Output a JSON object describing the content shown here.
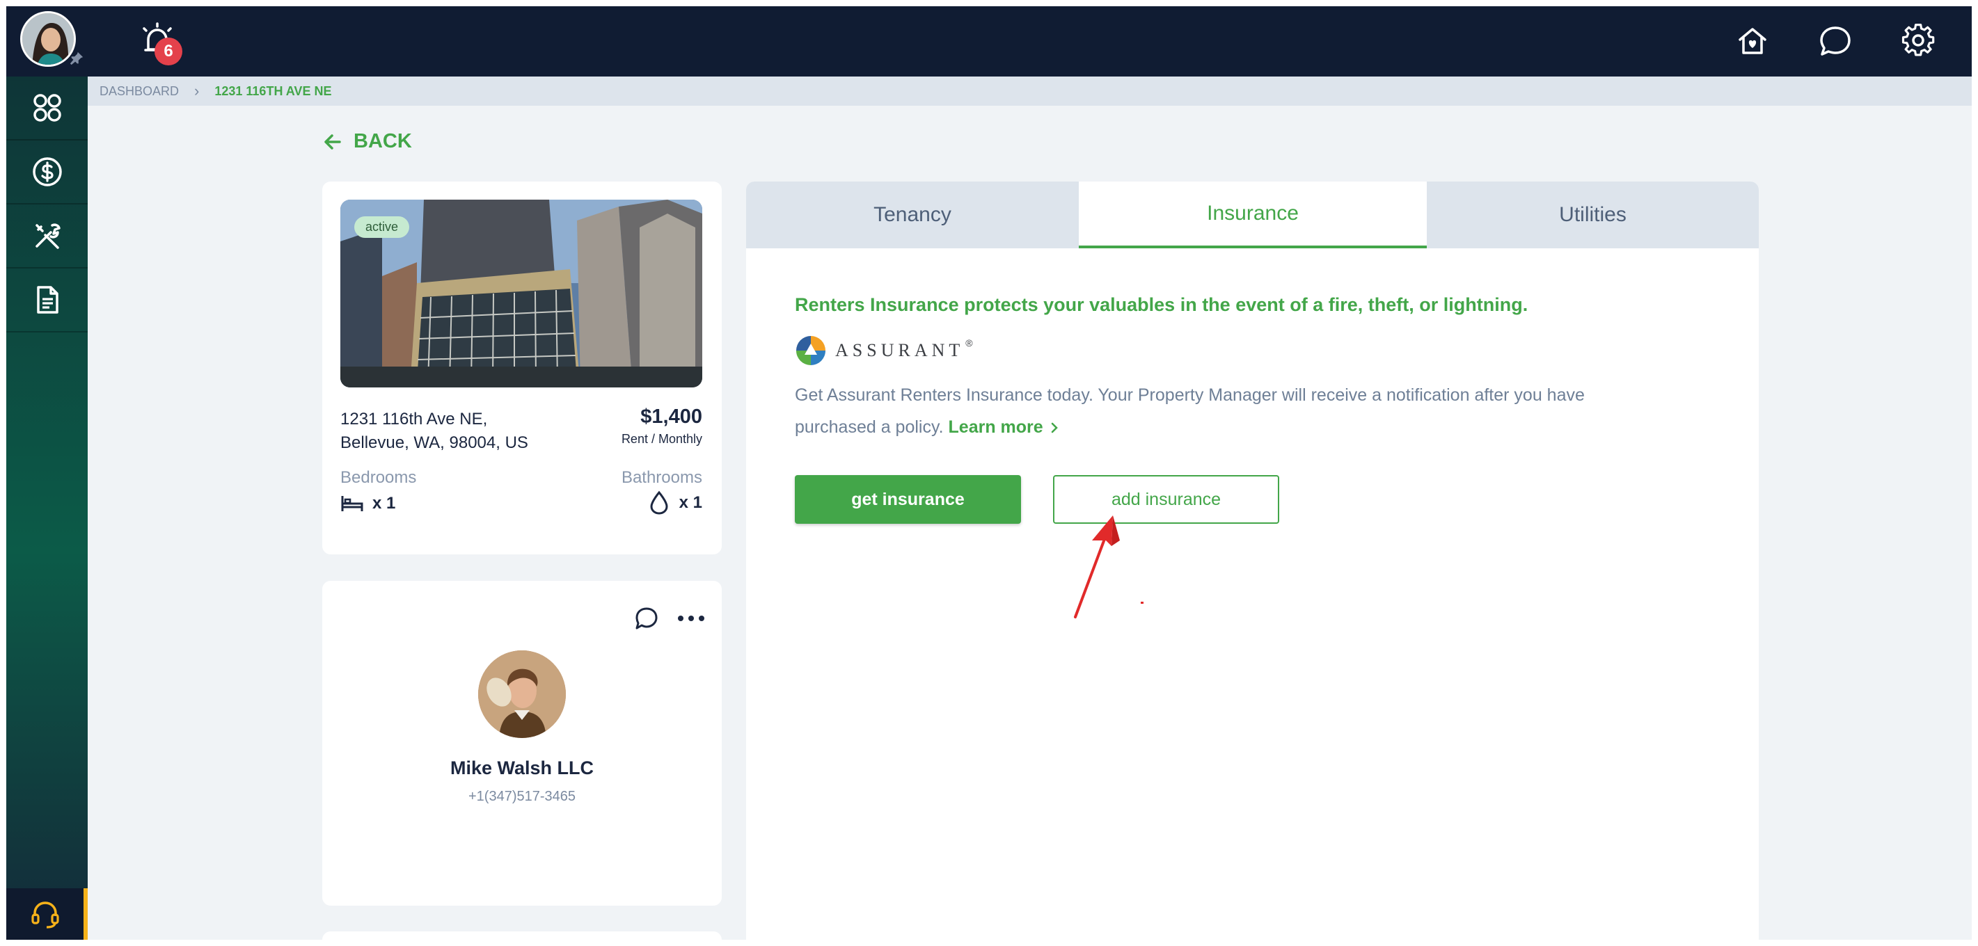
{
  "topbar": {
    "notification_count": "6",
    "icons": [
      "home-heart-icon",
      "chat-icon",
      "gear-icon"
    ]
  },
  "sidebar": {
    "items": [
      {
        "name": "dashboard-icon"
      },
      {
        "name": "payments-icon"
      },
      {
        "name": "maintenance-icon"
      },
      {
        "name": "documents-icon"
      }
    ],
    "support_icon": "headset-icon"
  },
  "breadcrumb": {
    "root": "DASHBOARD",
    "current": "1231 116TH AVE NE"
  },
  "back_label": "BACK",
  "property": {
    "status": "active",
    "address_line1": "1231 116th Ave NE,",
    "address_line2": "Bellevue, WA, 98004, US",
    "price": "$1,400",
    "rent_period": "Rent / Monthly",
    "bedrooms_label": "Bedrooms",
    "bedrooms_value": "x 1",
    "bathrooms_label": "Bathrooms",
    "bathrooms_value": "x 1"
  },
  "owner": {
    "name": "Mike Walsh LLC",
    "phone": "+1(347)517-3465"
  },
  "tabs": [
    {
      "label": "Tenancy",
      "active": false
    },
    {
      "label": "Insurance",
      "active": true
    },
    {
      "label": "Utilities",
      "active": false
    }
  ],
  "insurance": {
    "headline": "Renters Insurance protects your valuables in the event of a fire, theft, or lightning.",
    "provider": "ASSURANT",
    "provider_mark": "®",
    "description": "Get Assurant Renters Insurance today. Your Property Manager will receive a notification after you have purchased a policy.",
    "learn_more": "Learn more",
    "get_button": "get insurance",
    "add_button": "add insurance"
  },
  "colors": {
    "accent": "#43a649",
    "topbar": "#101c33",
    "badge": "#e4414b",
    "annotation": "#e12a2a"
  }
}
